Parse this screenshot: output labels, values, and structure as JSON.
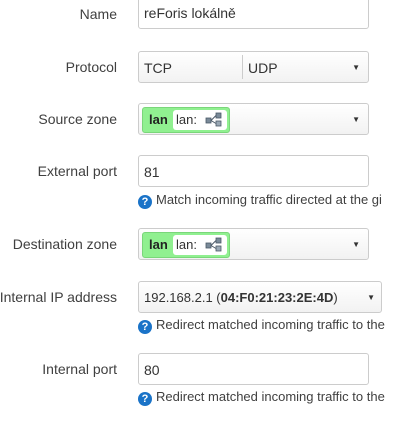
{
  "name": {
    "label": "Name",
    "value": "reForis lokálně"
  },
  "protocol": {
    "label": "Protocol",
    "options": [
      "TCP",
      "UDP"
    ]
  },
  "source_zone": {
    "label": "Source zone",
    "zone": "lan",
    "network": "lan:"
  },
  "external_port": {
    "label": "External port",
    "value": "81",
    "help": "Match incoming traffic directed at the gi"
  },
  "destination_zone": {
    "label": "Destination zone",
    "zone": "lan",
    "network": "lan:"
  },
  "internal_ip": {
    "label": "Internal IP address",
    "ip": "192.168.2.1",
    "mac_open": " (",
    "mac": "04:F0:21:23:2E:4D",
    "mac_close": ")",
    "help": "Redirect matched incoming traffic to the"
  },
  "internal_port": {
    "label": "Internal port",
    "value": "80",
    "help": "Redirect matched incoming traffic to the"
  },
  "icons": {
    "help": "help-icon",
    "dropdown": "chevron-down-icon",
    "network": "network-icon"
  },
  "colors": {
    "zone_badge": "#90f090",
    "help_icon": "#1a73c8"
  }
}
